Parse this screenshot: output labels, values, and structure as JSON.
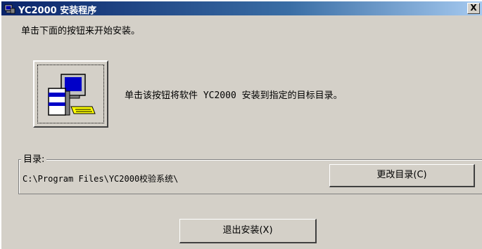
{
  "window": {
    "title": "YC2000 安装程序",
    "close_label": "X"
  },
  "main": {
    "intro_text": "单击下面的按钮来开始安装。",
    "install_description": "单击该按钮将软件 YC2000 安装到指定的目标目录。"
  },
  "directory": {
    "group_label": "目录:",
    "path": "C:\\Program Files\\YC2000校验系统\\",
    "change_button_label": "更改目录(C)"
  },
  "footer": {
    "exit_button_label": "退出安装(X)"
  },
  "icons": {
    "title_icon": "installer-icon",
    "install_icon": "computer-install-icon"
  }
}
